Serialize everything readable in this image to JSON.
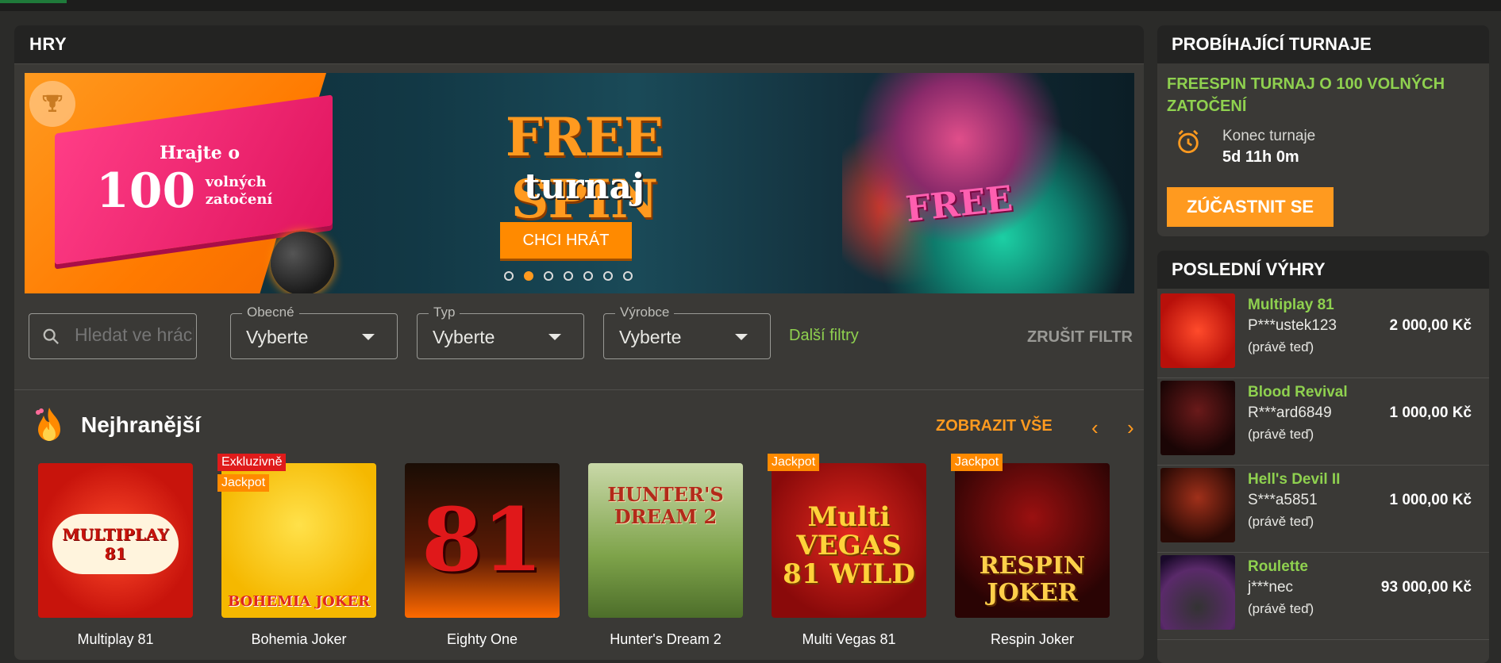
{
  "main": {
    "title": "HRY"
  },
  "banner": {
    "pink_line1": "Hrajte o",
    "pink_big": "100",
    "pink_small1": "volných",
    "pink_small2": "zatočení",
    "title": "FREE SPIN",
    "subtitle": "turnaj",
    "cta": "CHCI HRÁT",
    "art_text": "FREE",
    "slides": 7,
    "active_slide": 2
  },
  "filters": {
    "search_placeholder": "Hledat ve hrách",
    "general": {
      "label": "Obecné",
      "value": "Vyberte"
    },
    "type": {
      "label": "Typ",
      "value": "Vyberte"
    },
    "vendor": {
      "label": "Výrobce",
      "value": "Vyberte"
    },
    "more": "Další filtry",
    "clear": "ZRUŠIT FILTR"
  },
  "section": {
    "title": "Nejhranější",
    "show_all": "ZOBRAZIT VŠE",
    "prev": "‹",
    "next": "›"
  },
  "games": [
    {
      "name": "Multiplay 81",
      "art": "MULTIPLAY 81",
      "badges": []
    },
    {
      "name": "Bohemia Joker",
      "art": "BOHEMIA JOKER",
      "badges": [
        "Exkluzivně",
        "Jackpot"
      ]
    },
    {
      "name": "Eighty One",
      "art": "81",
      "badges": []
    },
    {
      "name": "Hunter's Dream 2",
      "art": "HUNTER'S DREAM 2",
      "badges": []
    },
    {
      "name": "Multi Vegas 81",
      "art": "Multi VEGAS 81 WILD",
      "badges": [
        "Jackpot"
      ]
    },
    {
      "name": "Respin Joker",
      "art": "RESPIN JOKER",
      "badges": [
        "Jackpot"
      ]
    }
  ],
  "tournament": {
    "header": "PROBÍHAJÍCÍ TURNAJE",
    "name": "FREESPIN TURNAJ O 100 VOLNÝCH ZATOČENÍ",
    "end_label": "Konec turnaje",
    "end_value": "5d 11h 0m",
    "join": "ZÚČASTNIT SE"
  },
  "wins": {
    "header": "POSLEDNÍ VÝHRY",
    "items": [
      {
        "game": "Multiplay 81",
        "user": "P***ustek123",
        "when": "(právě teď)",
        "amount": "2 000,00 Kč"
      },
      {
        "game": "Blood Revival",
        "user": "R***ard6849",
        "when": "(právě teď)",
        "amount": "1 000,00 Kč"
      },
      {
        "game": "Hell's Devil II",
        "user": "S***a5851",
        "when": "(právě teď)",
        "amount": "1 000,00 Kč"
      },
      {
        "game": "Roulette",
        "user": "j***nec",
        "when": "(právě teď)",
        "amount": "93 000,00 Kč"
      }
    ]
  },
  "colors": {
    "accent": "#ff9a1f",
    "green": "#8fd14f",
    "panel": "#3a3936",
    "header": "#232322"
  }
}
